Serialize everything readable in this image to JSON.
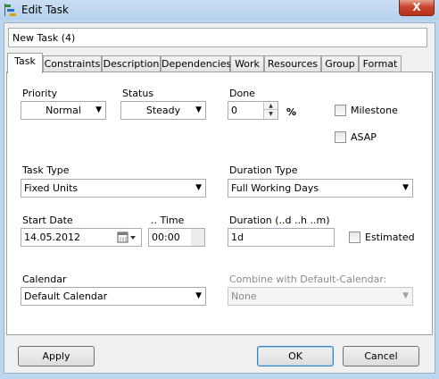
{
  "window": {
    "title": "Edit Task",
    "close_glyph": "X"
  },
  "task_name": "New Task (4)",
  "tabs": [
    "Task",
    "Constraints",
    "Description",
    "Dependencies",
    "Work",
    "Resources",
    "Group",
    "Format"
  ],
  "active_tab": "Task",
  "form": {
    "priority": {
      "label": "Priority",
      "value": "Normal"
    },
    "status": {
      "label": "Status",
      "value": "Steady"
    },
    "done": {
      "label": "Done",
      "value": "0",
      "unit": "%"
    },
    "milestone": {
      "label": "Milestone",
      "checked": false
    },
    "asap": {
      "label": "ASAP",
      "checked": false
    },
    "task_type": {
      "label": "Task Type",
      "value": "Fixed Units"
    },
    "duration_type": {
      "label": "Duration Type",
      "value": "Full Working Days"
    },
    "start_date": {
      "label": "Start Date",
      "value": "14.05.2012"
    },
    "time": {
      "label": ".. Time",
      "value": "00:00"
    },
    "duration": {
      "label": "Duration  (..d ..h ..m)",
      "value": "1d"
    },
    "estimated": {
      "label": "Estimated",
      "checked": false
    },
    "calendar": {
      "label": "Calendar",
      "value": "Default Calendar"
    },
    "combine": {
      "label": "Combine with Default-Calendar:",
      "value": "None",
      "disabled": true
    }
  },
  "buttons": {
    "apply": "Apply",
    "ok": "OK",
    "cancel": "Cancel"
  },
  "colors": {
    "titlebar": "#bcd6ee",
    "close": "#c9452f",
    "panel": "#ffffff",
    "dialog_bg": "#f0f0f0"
  },
  "icons": [
    "gantt-app-icon",
    "close-icon",
    "dropdown-arrow-icon",
    "spin-up-icon",
    "spin-down-icon",
    "calendar-icon"
  ]
}
